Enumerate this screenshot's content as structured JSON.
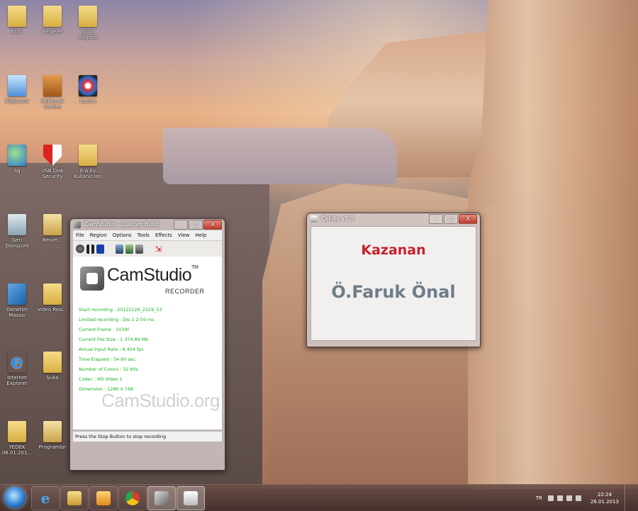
{
  "desktop": {
    "icons": [
      {
        "label": "Ebru",
        "kind": "folder"
      },
      {
        "label": "Belgeler",
        "kind": "folder"
      },
      {
        "label": "Şuka Ragıms",
        "kind": "folder"
      },
      {
        "label": "Bilgisayar",
        "kind": "computer"
      },
      {
        "label": "Nebleack Centes",
        "kind": "briefcase"
      },
      {
        "label": "Cyclan",
        "kind": "disc"
      },
      {
        "label": "Ağ",
        "kind": "network"
      },
      {
        "label": "USB Disk Security",
        "kind": "shield"
      },
      {
        "label": "E-A Ev Kullanıcıları",
        "kind": "folder"
      },
      {
        "label": "Geri Dönüşüm",
        "kind": "bin"
      },
      {
        "label": "Resim...",
        "kind": "folder"
      },
      {
        "label": "Denetim Masası",
        "kind": "panel"
      },
      {
        "label": "Video Resi...",
        "kind": "folder"
      },
      {
        "label": "Internet Explorer",
        "kind": "ie"
      },
      {
        "label": "Şuka",
        "kind": "folder"
      },
      {
        "label": "YEDEK 06.01.201...",
        "kind": "folder"
      },
      {
        "label": "Programlar",
        "kind": "folder"
      }
    ]
  },
  "camstudio": {
    "title": "CamStudio - Custom Build",
    "menu": [
      "File",
      "Region",
      "Options",
      "Tools",
      "Effects",
      "View",
      "Help"
    ],
    "logo": "CamStudio",
    "logo_tm": "TM",
    "logo_sub": "RECORDER",
    "stats": [
      "Start recording : 20121126_2229_53",
      "Limited recording : Dis 1 2:59 ms",
      "Current Frame : 1039f",
      "Current File Size : 1 374,89 Mb",
      "Actual Input Rate : 6.454 fps",
      "Time Elapsed : 54.60 sec",
      "Number of Colors : 32 bits",
      "Codec : MS Video 1",
      "Dimension : 1280 X 768"
    ],
    "watermark": "CamStudio.org",
    "status": "Press the Stop Button to stop recording"
  },
  "draw_dialog": {
    "title": "Çekiliş v1.0",
    "winner_label": "Kazanan",
    "winner_name": "Ö.Faruk Önal"
  },
  "window_controls": {
    "minimize": "–",
    "maximize": "□",
    "close": "X"
  },
  "taskbar": {
    "items": [
      "Internet Explorer",
      "Windows Explorer",
      "Media Player",
      "Google Chrome",
      "CamStudio",
      "Çekiliş"
    ],
    "tray_lang": "TR",
    "clock_time": "22:24",
    "clock_date": "26.01.2013"
  }
}
